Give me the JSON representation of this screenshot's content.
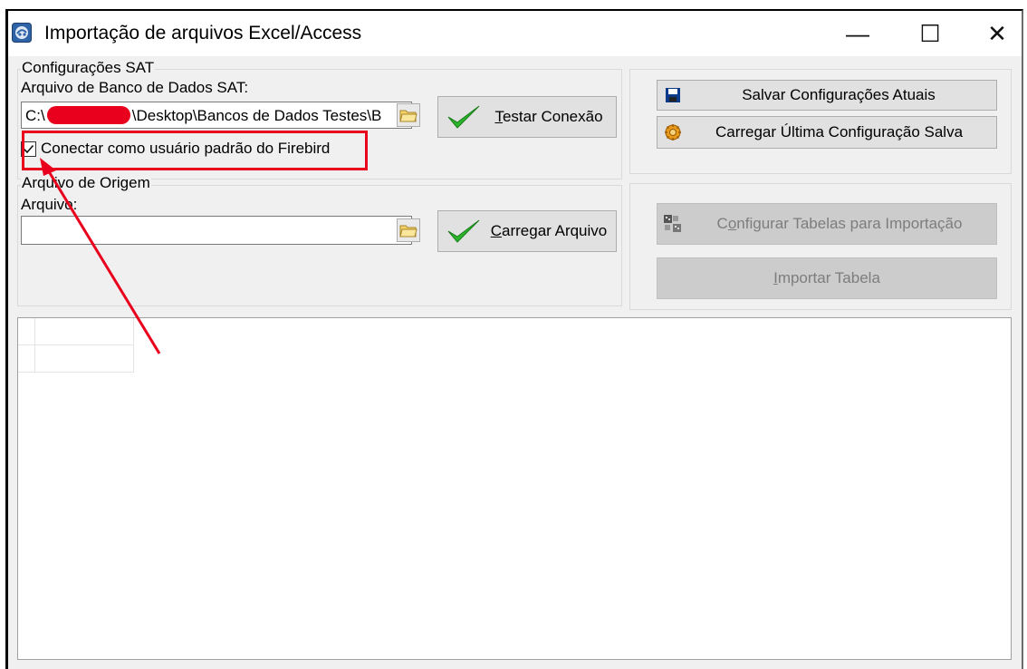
{
  "window": {
    "title": "Importação de arquivos Excel/Access",
    "controls": {
      "minimize": "—",
      "maximize": "☐",
      "close": "✕"
    }
  },
  "sat_config": {
    "group_label": "Configurações SAT",
    "db_file_label": "Arquivo de Banco de Dados SAT:",
    "db_path_prefix": "C:\\",
    "db_path_suffix": "\\Desktop\\Bancos de Dados Testes\\B",
    "test_button": {
      "mnemonic": "T",
      "rest": "estar Conexão"
    },
    "firebird_checkbox": {
      "label": "Conectar como usuário padrão do Firebird",
      "checked": true
    }
  },
  "config_actions": {
    "save_label": "Salvar Configurações Atuais",
    "load_label": "Carregar Última Configuração Salva"
  },
  "origin": {
    "group_label": "Arquivo de Origem",
    "file_label": "Arquivo:",
    "file_value": "",
    "load_button": {
      "mnemonic": "C",
      "rest": "arregar Arquivo"
    }
  },
  "import_actions": {
    "configure_button": {
      "mnemonic": "o",
      "pre": "C",
      "rest": "nfigurar Tabelas para Importação"
    },
    "import_button": {
      "mnemonic": "I",
      "rest": "mportar Tabela"
    }
  },
  "colors": {
    "highlight_red": "#e8001c",
    "check_green": "#2bb52b",
    "window_bg": "#f0f0f0"
  }
}
